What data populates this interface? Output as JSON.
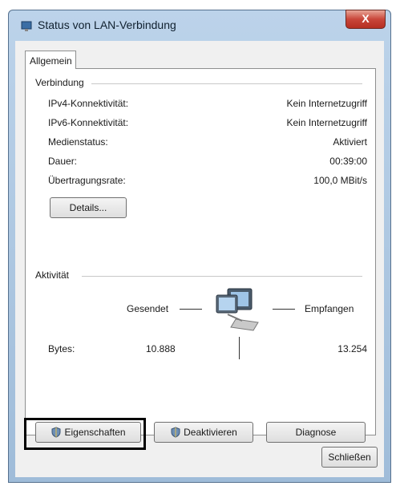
{
  "window": {
    "title": "Status von LAN-Verbindung",
    "close_label": "X"
  },
  "tab": {
    "label": "Allgemein"
  },
  "connection": {
    "group_label": "Verbindung",
    "rows": [
      {
        "label": "IPv4-Konnektivität:",
        "value": "Kein Internetzugriff"
      },
      {
        "label": "IPv6-Konnektivität:",
        "value": "Kein Internetzugriff"
      },
      {
        "label": "Medienstatus:",
        "value": "Aktiviert"
      },
      {
        "label": "Dauer:",
        "value": "00:39:00"
      },
      {
        "label": "Übertragungsrate:",
        "value": "100,0 MBit/s"
      }
    ],
    "details_button": "Details..."
  },
  "activity": {
    "group_label": "Aktivität",
    "sent_label": "Gesendet",
    "received_label": "Empfangen",
    "bytes_label": "Bytes:",
    "bytes_sent": "10.888",
    "bytes_received": "13.254"
  },
  "buttons": {
    "properties": "Eigenschaften",
    "deactivate": "Deaktivieren",
    "diagnose": "Diagnose",
    "close": "Schließen"
  },
  "icons": {
    "title": "network-icon",
    "activity": "computer-network-icon",
    "shield": "uac-shield-icon"
  }
}
